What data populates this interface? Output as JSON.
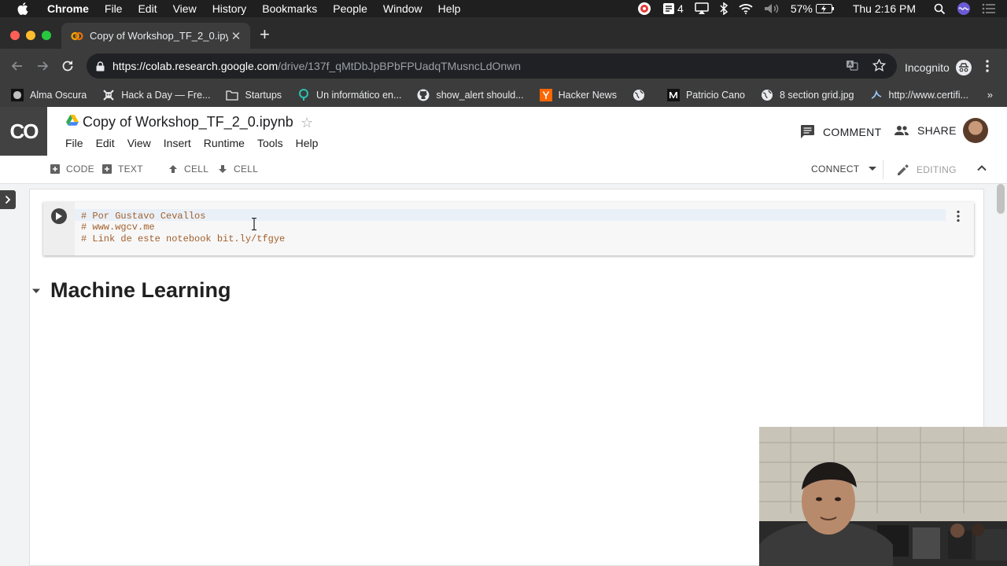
{
  "macos_menubar": {
    "app_name": "Chrome",
    "menus": [
      "File",
      "Edit",
      "View",
      "History",
      "Bookmarks",
      "People",
      "Window",
      "Help"
    ],
    "status": {
      "notification_count": "4",
      "battery": "57%",
      "clock": "Thu 2:16 PM"
    }
  },
  "browser": {
    "tab_title": "Copy of Workshop_TF_2_0.ipynb",
    "url_host": "https://colab.research.google.com",
    "url_path": "/drive/137f_qMtDbJpBPbFPUadqTMusncLdOnwn",
    "profile_label": "Incognito",
    "bookmarks": [
      {
        "label": "Alma Oscura",
        "icon": "alma-oscura-icon",
        "color": "#1a1a1a"
      },
      {
        "label": "Hack a Day — Fre...",
        "icon": "hackaday-icon",
        "color": "#e8eaed"
      },
      {
        "label": "Startups",
        "icon": "folder-icon",
        "color": "#e8eaed"
      },
      {
        "label": "Un informático en...",
        "icon": "informatico-icon",
        "color": "#27c4b4"
      },
      {
        "label": "show_alert should...",
        "icon": "github-icon",
        "color": "#e8eaed"
      },
      {
        "label": "Hacker News",
        "icon": "hacker-news-icon",
        "color": "#ff6600"
      },
      {
        "label": "",
        "icon": "globe-icon",
        "color": "#e8eaed"
      },
      {
        "label": "Patricio Cano",
        "icon": "medium-icon",
        "color": "#e8eaed"
      },
      {
        "label": "8 section grid.jpg",
        "icon": "globe-icon",
        "color": "#e8eaed"
      },
      {
        "label": "http://www.certifi...",
        "icon": "certifi-icon",
        "color": "#e8eaed"
      }
    ],
    "bookmarks_overflow": "»"
  },
  "colab": {
    "logo_text": "CO",
    "notebook_title": "Copy of Workshop_TF_2_0.ipynb",
    "menu": [
      "File",
      "Edit",
      "View",
      "Insert",
      "Runtime",
      "Tools",
      "Help"
    ],
    "comment_label": "COMMENT",
    "share_label": "SHARE",
    "toolbar": {
      "add_code": "CODE",
      "add_text": "TEXT",
      "cell_up": "CELL",
      "cell_down": "CELL",
      "connect": "CONNECT",
      "editing": "EDITING"
    },
    "code_cell": {
      "lines": [
        "# Por Gustavo Cevallos",
        "# www.wgcv.me",
        "# Link de este notebook bit.ly/tfgye"
      ]
    },
    "section_heading": "Machine Learning"
  },
  "colors": {
    "accent_comment": "#a1602d",
    "chrome_dark": "#3c3c3c",
    "colab_logo_bg": "#424242"
  }
}
